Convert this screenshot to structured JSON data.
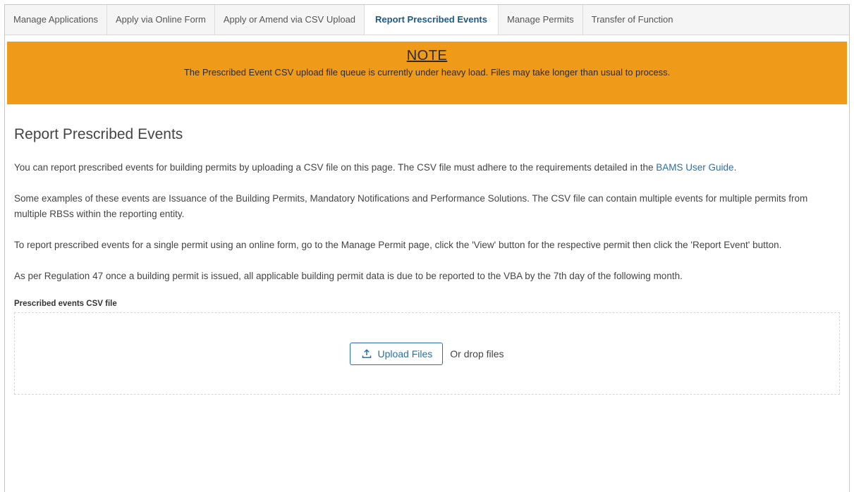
{
  "tabs": [
    {
      "label": "Manage Applications"
    },
    {
      "label": "Apply via Online Form"
    },
    {
      "label": "Apply or Amend via CSV Upload"
    },
    {
      "label": "Report Prescribed Events",
      "active": true
    },
    {
      "label": "Manage Permits"
    },
    {
      "label": "Transfer of Function"
    }
  ],
  "note": {
    "title": "NOTE",
    "text": "The Prescribed Event CSV upload file queue is currently under heavy load. Files may take longer than usual to process.",
    "background": "#f09a1a"
  },
  "page": {
    "title": "Report Prescribed Events",
    "p1_text": "You can report prescribed events for building permits by uploading a CSV file on this page. The CSV file must adhere to the requirements detailed in the ",
    "p1_link": "BAMS User Guide",
    "p1_end": ".",
    "p2": "Some examples of these events are Issuance of the Building Permits, Mandatory Notifications and Performance Solutions. The CSV file can contain multiple events for multiple permits from multiple RBSs within the reporting entity.",
    "p3": "To report prescribed events for a single permit using an online form, go to the Manage Permit page, click the 'View' button for the respective permit then click the 'Report Event' button.",
    "p4": "As per Regulation 47 once a building permit is issued, all applicable building permit data is due to be reported to the VBA by the 7th day of the following month."
  },
  "upload": {
    "label": "Prescribed events CSV file",
    "button_label": "Upload Files",
    "button_icon": "upload-icon",
    "drop_text": "Or drop files"
  },
  "colors": {
    "accent": "#2a6fa8",
    "active_tab": "#1a5b8a"
  }
}
